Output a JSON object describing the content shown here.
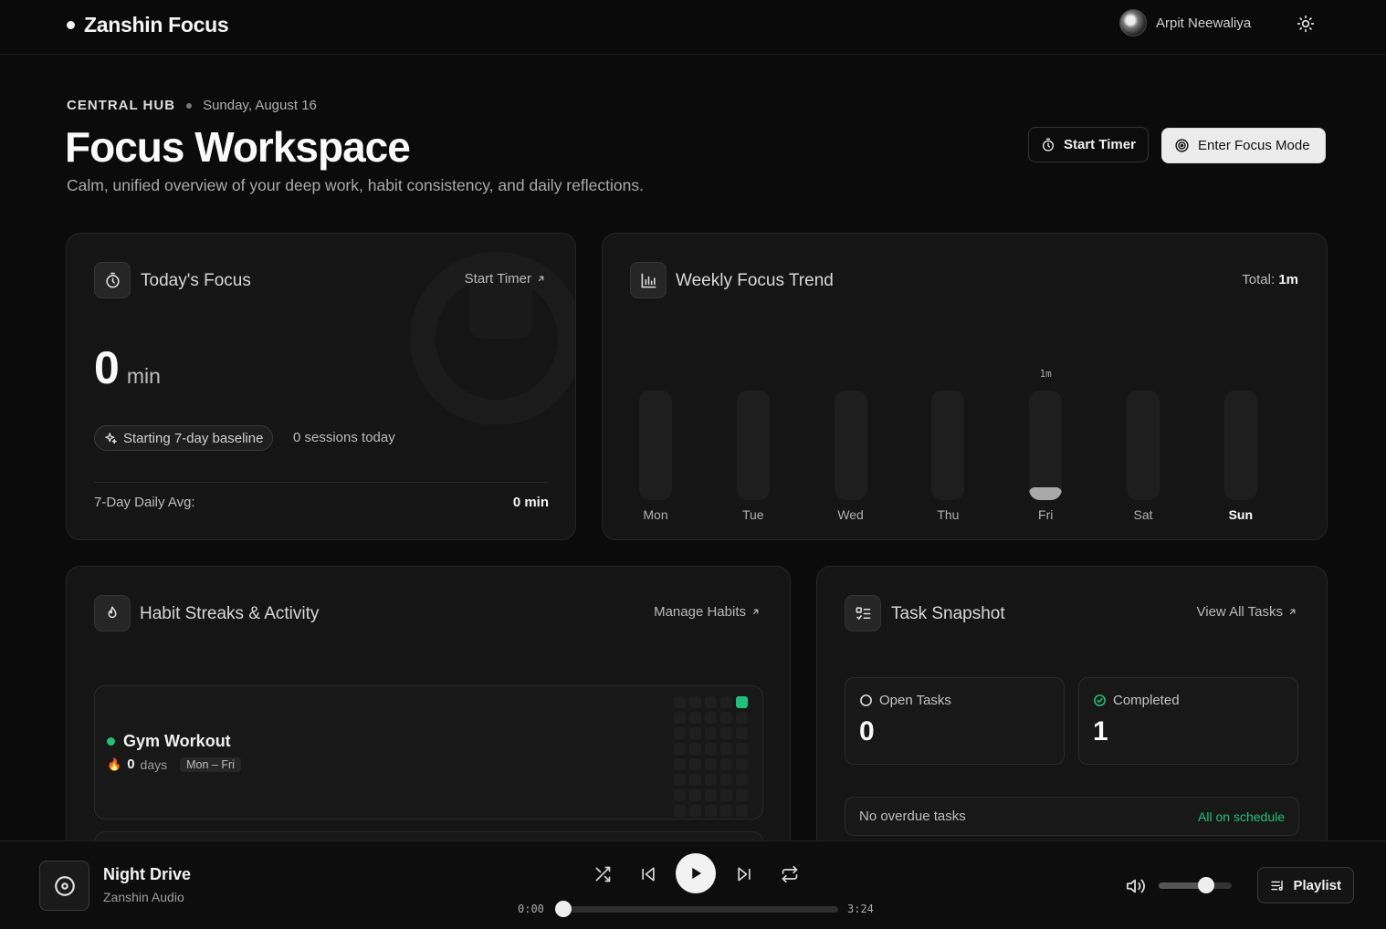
{
  "app": {
    "name": "Zanshin Focus",
    "user_name": "Arpit Neewaliya"
  },
  "header": {
    "eyebrow": "CENTRAL HUB",
    "date": "Sunday, August 16",
    "title": "Focus Workspace",
    "subtitle": "Calm, unified overview of your deep work, habit consistency, and daily reflections.",
    "start_timer_label": "Start Timer",
    "focus_mode_label": "Enter Focus Mode"
  },
  "today_focus": {
    "title": "Today's Focus",
    "link": "Start Timer",
    "value": "0",
    "unit": "min",
    "baseline_pill": "Starting 7-day baseline",
    "sessions": "0 sessions today",
    "avg_label": "7-Day Daily Avg:",
    "avg_value": "0 min"
  },
  "weekly_trend": {
    "title": "Weekly Focus Trend",
    "total_label": "Total:",
    "total_value": "1m"
  },
  "chart_data": {
    "type": "bar",
    "categories": [
      "Mon",
      "Tue",
      "Wed",
      "Thu",
      "Fri",
      "Sat",
      "Sun"
    ],
    "values": [
      0,
      0,
      0,
      0,
      1,
      0,
      0
    ],
    "value_labels": [
      "",
      "",
      "",
      "",
      "1m",
      "",
      ""
    ],
    "ylim": [
      0,
      10
    ],
    "highlight": "Sun",
    "title": "",
    "xlabel": "",
    "ylabel": ""
  },
  "habits": {
    "title": "Habit Streaks & Activity",
    "link": "Manage Habits",
    "items": [
      {
        "name": "Gym Workout",
        "streak": "0",
        "streak_unit": "days",
        "schedule": "Mon – Fri"
      }
    ],
    "heatmap_on_cells": [
      4,
      44
    ]
  },
  "tasks": {
    "title": "Task Snapshot",
    "link": "View All Tasks",
    "open_label": "Open Tasks",
    "open_value": "0",
    "completed_label": "Completed",
    "completed_value": "1",
    "overdue_text": "No overdue tasks",
    "overdue_status": "All on schedule"
  },
  "player": {
    "title": "Night Drive",
    "artist": "Zanshin Audio",
    "elapsed": "0:00",
    "duration": "3:24",
    "progress": 0,
    "volume": 0.65,
    "playlist_label": "Playlist"
  },
  "colors": {
    "accent_green": "#1ec27b",
    "bar_fill": "#a9a9a9",
    "background": "#0b0b0b"
  }
}
